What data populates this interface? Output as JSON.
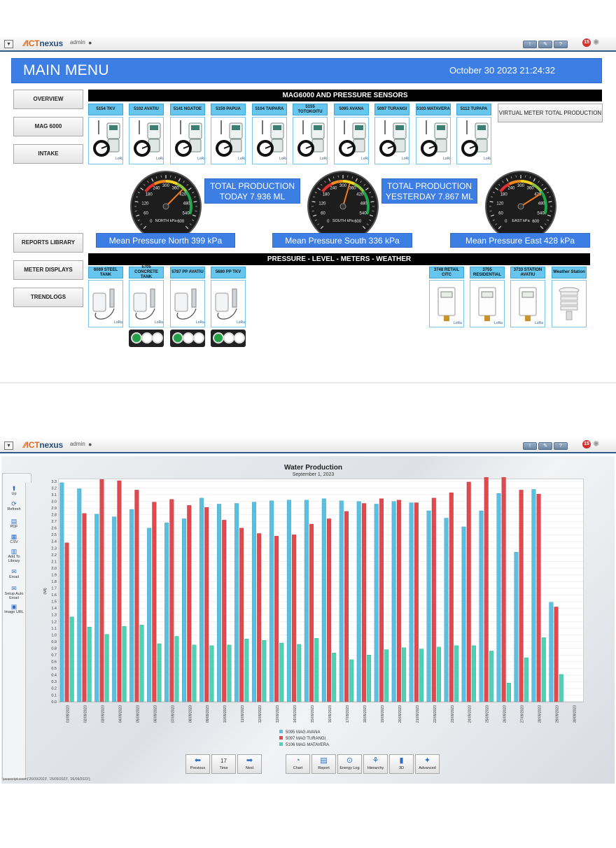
{
  "app": {
    "logo_prefix": "ICT",
    "logo_suffix": "nexus",
    "user": "admin",
    "alert_count": "15"
  },
  "panel1": {
    "title": "MAIN MENU",
    "datetime": "October 30 2023 21:24:32",
    "nav": [
      "OVERVIEW",
      "MAG 6000",
      "INTAKE",
      "REPORTS LIBRARY",
      "METER DISPLAYS",
      "TRENDLOGS"
    ],
    "section1": "MAG6000 AND PRESSURE SENSORS",
    "sensors": [
      "5154 TKV",
      "5102 AVATIU",
      "5141 NGATOE",
      "5159 PAPUA",
      "5104 TAIPARA",
      "5155 TOTOKOITU",
      "5095 AVANA",
      "5097 TURANGI",
      "5103 MATAVERA",
      "5112 TUPAPA"
    ],
    "virtual_meter": "VIRTUAL METER TOTAL PRODUCTION",
    "gauges": [
      {
        "label": "NORTH kPa",
        "value": 399
      },
      {
        "label": "SOUTH kPa",
        "value": 336
      },
      {
        "label": "EAST kPa",
        "value": 428
      }
    ],
    "gauge_ticks": [
      "0",
      "60",
      "120",
      "180",
      "240",
      "300",
      "360",
      "420",
      "480",
      "540",
      "600"
    ],
    "total_today": "TOTAL PRODUCTION TODAY 7.936 ML",
    "total_yesterday": "TOTAL PRODUCTION YESTERDAY 7.867 ML",
    "mean_north": "Mean Pressure North 399 kPa",
    "mean_south": "Mean Pressure South 336 kPa",
    "mean_east": "Mean Pressure East 428 kPa",
    "section2": "PRESSURE - LEVEL - METERS - WEATHER",
    "level_sensors": [
      "6089 STEEL TANK",
      "5705 CONCRETE TANK",
      "5787 PP AVATIU",
      "5680 PP TKV"
    ],
    "meter_sensors": [
      "3748 RETAIL CITC",
      "3755 RESIDENTIAL",
      "3733 STATION AVATIU",
      "Weather Station"
    ]
  },
  "panel2": {
    "sidebar": [
      "Up",
      "Refresh",
      "PDF",
      "CSV",
      "Add To Library",
      "Email",
      "Setup Auto Email",
      "Image URL"
    ],
    "bottom_buttons": [
      "Previous",
      "Time",
      "Next",
      "Chart",
      "Report",
      "Energy Log",
      "Hierarchy",
      "3D",
      "Advanced"
    ],
    "time_icon_day": "17",
    "status_text": "javascript:zoom('26/09/2023', '26/09/2023', '26/09/2023');"
  },
  "colors": {
    "blue_series": "#5bbfe0",
    "red_series": "#e04a4f",
    "teal_series": "#4fd1b3",
    "accent": "#3d7ee5"
  },
  "chart_data": {
    "type": "bar",
    "title": "Water Production",
    "subtitle": "September 1, 2023",
    "ylabel": "(Ml)",
    "ylim": [
      0,
      3.3
    ],
    "yticks": [
      "0.0",
      "0.1",
      "0.2",
      "0.3",
      "0.4",
      "0.5",
      "0.6",
      "0.7",
      "0.8",
      "0.9",
      "1.0",
      "1.1",
      "1.2",
      "1.3",
      "1.4",
      "1.5",
      "1.6",
      "1.7",
      "1.8",
      "1.9",
      "2.0",
      "2.1",
      "2.2",
      "2.3",
      "2.4",
      "2.5",
      "2.6",
      "2.7",
      "2.8",
      "2.9",
      "3.0",
      "3.1",
      "3.2",
      "3.3"
    ],
    "grid": true,
    "categories": [
      "01/09/2023",
      "02/09/2023",
      "03/09/2023",
      "04/09/2023",
      "05/09/2023",
      "06/09/2023",
      "07/09/2023",
      "08/09/2023",
      "09/09/2023",
      "10/09/2023",
      "11/09/2023",
      "12/09/2023",
      "13/09/2023",
      "14/09/2023",
      "15/09/2023",
      "16/09/2023",
      "17/09/2023",
      "18/09/2023",
      "19/09/2023",
      "20/09/2023",
      "21/09/2023",
      "22/09/2023",
      "23/09/2023",
      "24/09/2023",
      "25/09/2023",
      "26/09/2023",
      "27/09/2023",
      "28/09/2023",
      "29/09/2023",
      "30/09/2023"
    ],
    "series": [
      {
        "name": "5095 MAG AVANA",
        "values": [
          3.28,
          3.19,
          2.81,
          2.77,
          2.88,
          2.6,
          2.68,
          2.74,
          3.05,
          2.96,
          2.97,
          2.99,
          3.01,
          3.02,
          3.02,
          3.04,
          3.01,
          3.0,
          2.96,
          3.0,
          2.98,
          2.86,
          2.75,
          2.62,
          2.86,
          3.12,
          2.24,
          3.18,
          1.49,
          0
        ]
      },
      {
        "name": "5097 MAG TURANGI",
        "values": [
          2.38,
          2.82,
          3.33,
          3.31,
          3.17,
          2.99,
          3.03,
          2.94,
          2.91,
          2.72,
          2.6,
          2.52,
          2.48,
          2.5,
          2.66,
          2.74,
          2.85,
          2.97,
          3.04,
          3.02,
          2.98,
          3.05,
          3.13,
          3.29,
          3.36,
          3.36,
          3.17,
          3.11,
          1.42,
          0
        ]
      },
      {
        "name": "5106 MAG MATAVERA",
        "values": [
          1.27,
          1.12,
          1.01,
          1.13,
          1.15,
          0.87,
          0.98,
          0.85,
          0.84,
          0.85,
          0.94,
          0.92,
          0.88,
          0.86,
          0.95,
          0.73,
          0.63,
          0.7,
          0.78,
          0.81,
          0.79,
          0.82,
          0.84,
          0.84,
          0.76,
          0.28,
          0.66,
          0.96,
          0.41,
          0
        ]
      }
    ],
    "legend_position": "bottom"
  }
}
